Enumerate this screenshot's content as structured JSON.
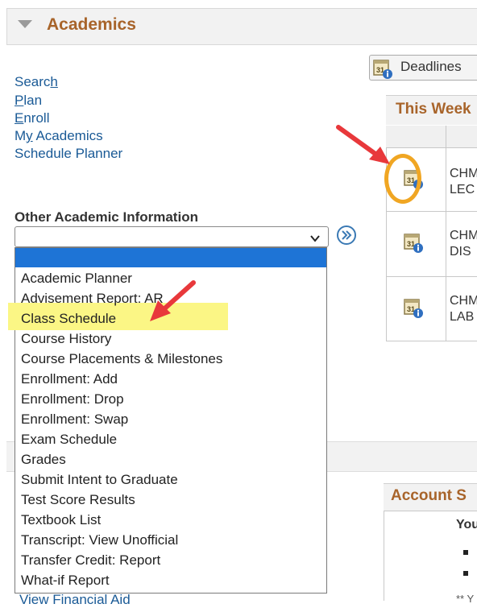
{
  "section": {
    "title": "Academics"
  },
  "nav_links": [
    {
      "label_pre": "Searc",
      "label_u": "h",
      "label_post": ""
    },
    {
      "label_pre": "",
      "label_u": "P",
      "label_post": "lan"
    },
    {
      "label_pre": "",
      "label_u": "E",
      "label_post": "nroll"
    },
    {
      "label_pre": "M",
      "label_u": "y",
      "label_post": " Academics"
    },
    {
      "label_pre": "Schedule Planner",
      "label_u": "",
      "label_post": ""
    }
  ],
  "other_academic": {
    "label": "Other Academic Information",
    "selected_value": "",
    "options": [
      "Academic Planner",
      "Advisement Report: AR",
      "Class Schedule",
      "Course History",
      "Course Placements & Milestones",
      "Enrollment: Add",
      "Enrollment: Drop",
      "Enrollment: Swap",
      "Exam Schedule",
      "Grades",
      "Submit Intent to Graduate",
      "Test Score Results",
      "Textbook List",
      "Transcript: View Unofficial",
      "Transfer Credit: Report",
      "What-if Report"
    ],
    "highlighted_option": "Class Schedule"
  },
  "deadlines": {
    "label": "Deadlines"
  },
  "this_week": {
    "title": "This Week",
    "rows": [
      {
        "line1": "CHM",
        "line2": "LEC"
      },
      {
        "line1": "CHM",
        "line2": "DIS"
      },
      {
        "line1": "CHM",
        "line2": "LAB"
      }
    ]
  },
  "account": {
    "title": "Account S",
    "you": "You",
    "footnote": "** Y"
  },
  "footer_link": "View Financial Aid",
  "colors": {
    "accent": "#a8642a",
    "link": "#1a5a96",
    "selection": "#1e74d6",
    "highlight": "#fbf685",
    "annotation_ring": "#f0a623",
    "annotation_arrow": "#e8383b"
  },
  "icons": {
    "collapse": "triangle-down-icon",
    "chevron": "chevron-down-icon",
    "go": "double-chevron-right-icon",
    "calendar": "calendar-info-icon",
    "arrow": "red-arrow-icon"
  }
}
